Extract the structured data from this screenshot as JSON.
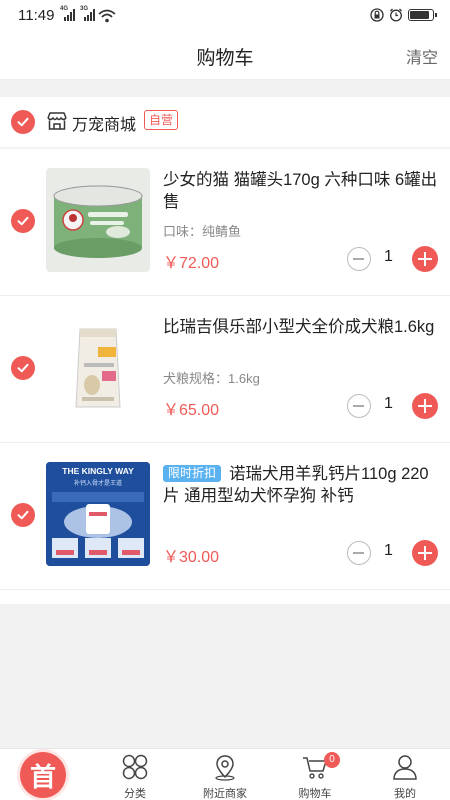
{
  "status_bar": {
    "time": "11:49",
    "signal_tag_1": "4G",
    "signal_tag_2": "3G"
  },
  "header": {
    "title": "购物车",
    "clear_label": "清空"
  },
  "shop": {
    "name": "万宠商城",
    "tag": "自营"
  },
  "items": [
    {
      "title": "少女的猫 猫罐头170g 六种口味 6罐出售",
      "promo": "",
      "spec": "口味：纯鲭鱼",
      "price": "￥72.00",
      "quantity": "1",
      "image_icon": "canned-cat-food"
    },
    {
      "title": "比瑞吉俱乐部小型犬全价成犬粮1.6kg",
      "promo": "",
      "spec": "犬粮规格：1.6kg",
      "price": "￥65.00",
      "quantity": "1",
      "image_icon": "dog-food-bag"
    },
    {
      "title": "诺瑞犬用羊乳钙片110g 220片 通用型幼犬怀孕狗 补钙",
      "promo": "限时折扣",
      "spec": "",
      "price": "￥30.00",
      "quantity": "1",
      "image_icon": "calcium-tablets-ad",
      "image_text": {
        "headline": "THE KINGLY WAY",
        "sub": "补钙入骨才是王道"
      }
    }
  ],
  "tabbar": {
    "home_char": "首",
    "tabs": [
      {
        "label": "分类",
        "icon": "category-icon"
      },
      {
        "label": "附近商家",
        "icon": "location-icon"
      },
      {
        "label": "购物车",
        "icon": "cart-icon",
        "badge": "0"
      },
      {
        "label": "我的",
        "icon": "user-icon"
      }
    ]
  },
  "colors": {
    "accent": "#ef5a56",
    "promo": "#5ab2f0",
    "background": "#f2f2f2"
  }
}
